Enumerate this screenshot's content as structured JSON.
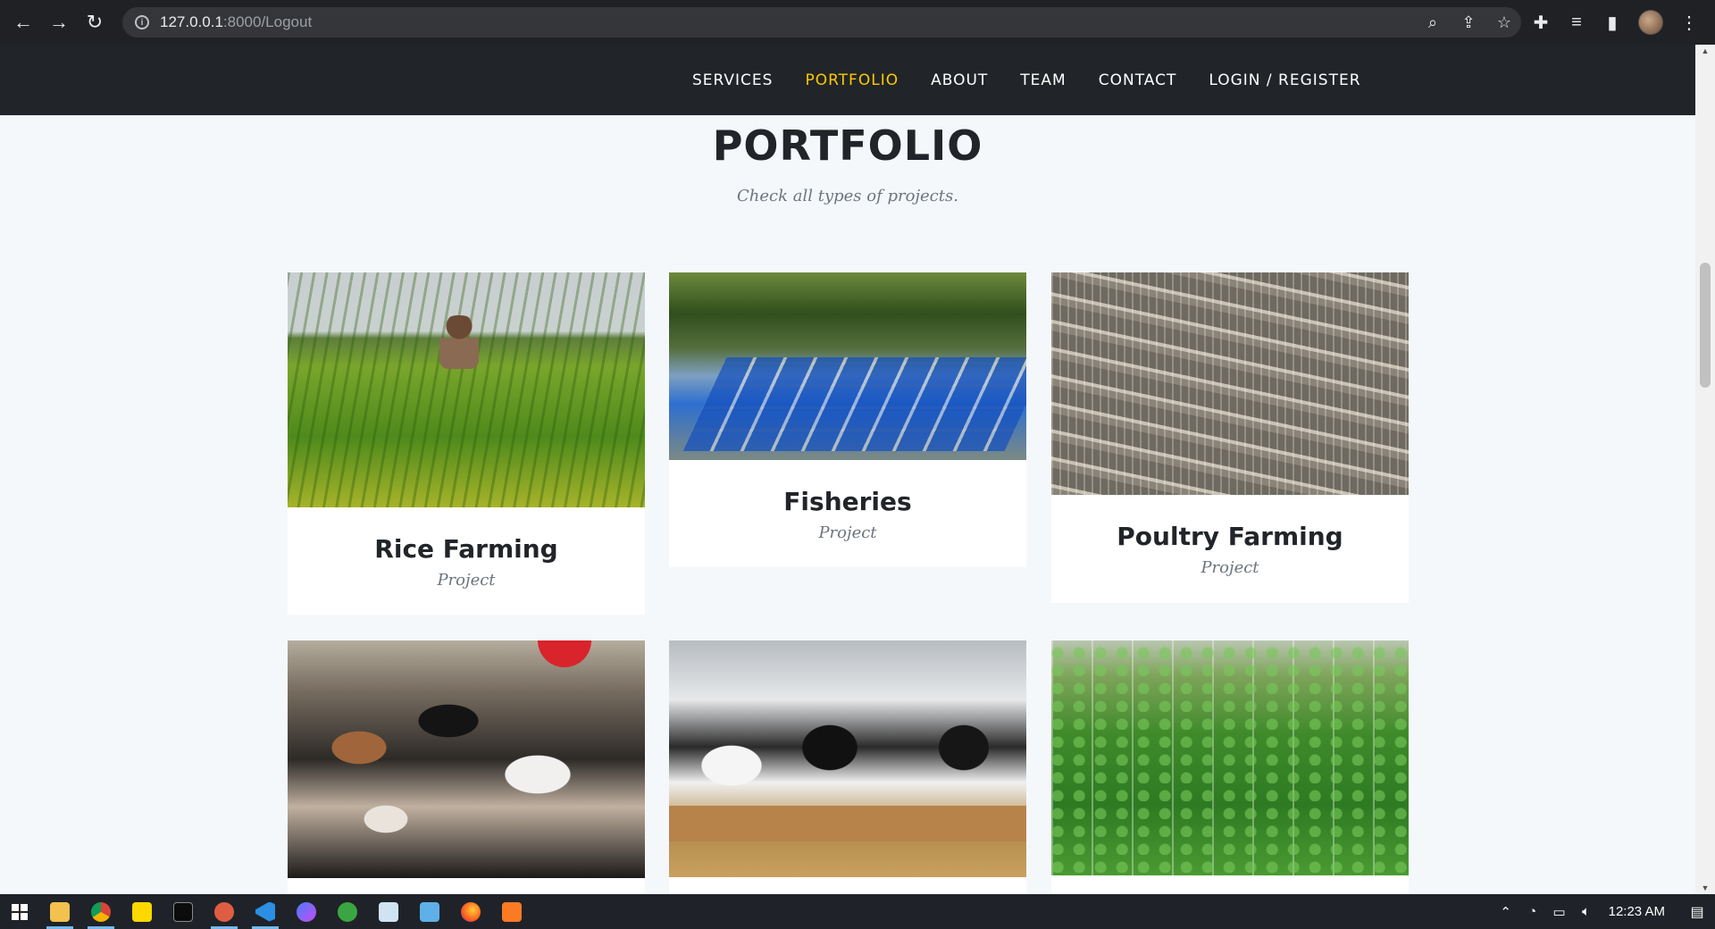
{
  "browser": {
    "url_host": "127.0.0.1",
    "url_rest": ":8000/Logout",
    "back_icon": "arrow-left-icon",
    "forward_icon": "arrow-right-icon",
    "reload_icon": "reload-icon"
  },
  "nav": {
    "items": [
      {
        "label": "SERVICES",
        "active": false
      },
      {
        "label": "PORTFOLIO",
        "active": true
      },
      {
        "label": "ABOUT",
        "active": false
      },
      {
        "label": "TEAM",
        "active": false
      },
      {
        "label": "CONTACT",
        "active": false
      },
      {
        "label": "LOGIN / REGISTER",
        "active": false
      }
    ],
    "background": "#212529",
    "active_color": "#ffc800"
  },
  "portfolio": {
    "title": "PORTFOLIO",
    "subtitle": "Check all types of projects.",
    "items": [
      {
        "title": "Rice Farming",
        "subtitle": "Project",
        "image": "rice-field-farmer-photo"
      },
      {
        "title": "Fisheries",
        "subtitle": "Project",
        "image": "fish-ponds-photo"
      },
      {
        "title": "Poultry Farming",
        "subtitle": "Project",
        "image": "poultry-cages-photo"
      },
      {
        "title": "",
        "subtitle": "",
        "image": "goats-feeding-photo"
      },
      {
        "title": "",
        "subtitle": "",
        "image": "dairy-cows-barn-photo"
      },
      {
        "title": "",
        "subtitle": "",
        "image": "greenhouse-vegetables-photo"
      }
    ]
  },
  "taskbar": {
    "clock": "12:23 AM",
    "apps": [
      "file-explorer-icon",
      "chrome-icon",
      "sticky-notes-icon",
      "terminal-icon",
      "git-client-icon",
      "vscode-icon",
      "messenger-icon",
      "coreldraw-icon",
      "notepad-icon",
      "paint-icon",
      "firefox-icon",
      "xampp-icon"
    ]
  }
}
